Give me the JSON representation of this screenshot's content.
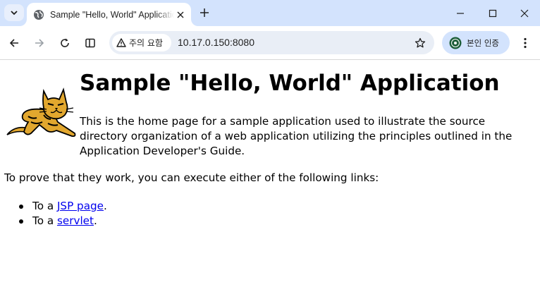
{
  "browser": {
    "tab_title": "Sample \"Hello, World\" Application",
    "security_chip": "주의 요함",
    "url": "10.17.0.150:8080",
    "profile_label": "본인 인증",
    "icons": [
      "tab-search-icon",
      "globe-icon",
      "close-icon",
      "plus-icon",
      "minimize-icon",
      "maximize-icon",
      "window-close-icon",
      "back-icon",
      "forward-icon",
      "reload-icon",
      "split-view-icon",
      "warning-icon",
      "star-icon",
      "avatar",
      "kebab-menu-icon"
    ]
  },
  "page": {
    "title": "Sample \"Hello, World\" Application",
    "intro": "This is the home page for a sample application used to illustrate the source directory organization of a web application utilizing the principles outlined in the Application Developer's Guide.",
    "prove_text": "To prove that they work, you can execute either of the following links:",
    "links": [
      {
        "prefix": "To a ",
        "link": "JSP page",
        "suffix": "."
      },
      {
        "prefix": "To a ",
        "link": "servlet",
        "suffix": "."
      }
    ]
  },
  "colors": {
    "tabstrip": "#d3e3fd",
    "omnibox": "#e9eef6",
    "link": "#0000ee",
    "logo_yellow": "#e2a72e"
  }
}
